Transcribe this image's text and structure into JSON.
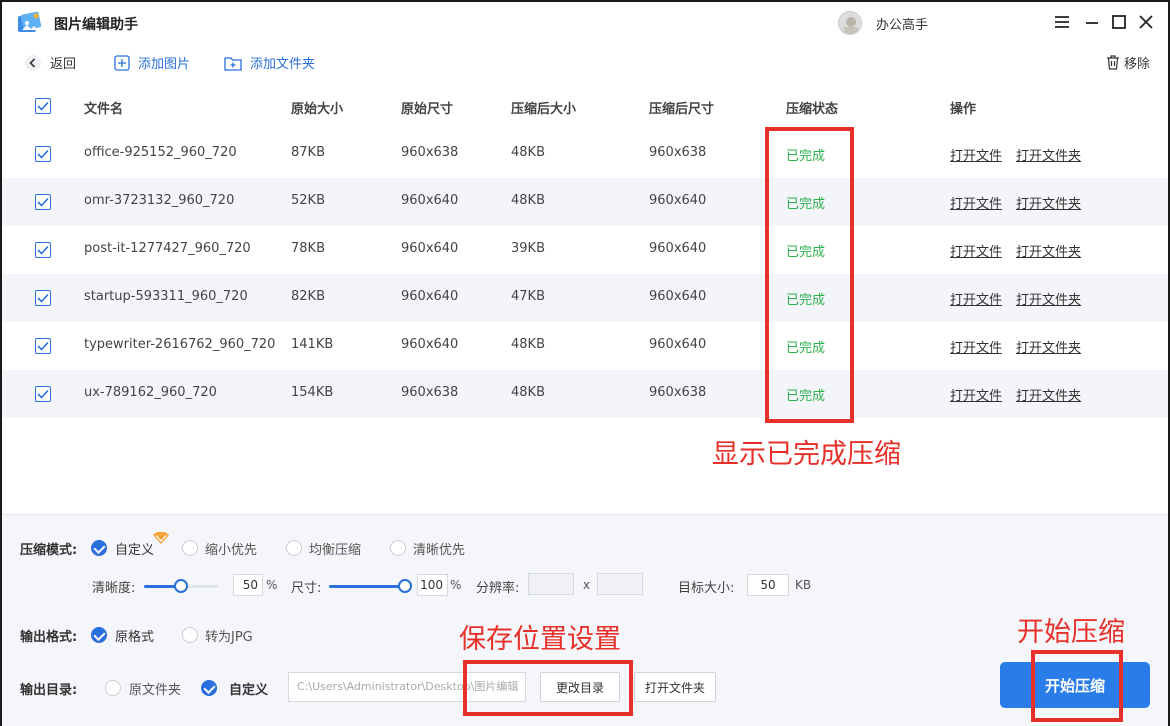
{
  "app": {
    "title": "图片编辑助手",
    "user_name": "办公高手"
  },
  "toolbar": {
    "back": "返回",
    "add_image": "添加图片",
    "add_folder": "添加文件夹",
    "remove": "移除"
  },
  "table": {
    "headers": [
      "文件名",
      "原始大小",
      "原始尺寸",
      "压缩后大小",
      "压缩后尺寸",
      "压缩状态",
      "操作"
    ],
    "rows": [
      {
        "name": "office-925152_960_720",
        "orig_size": "87KB",
        "orig_dim": "960x638",
        "new_size": "48KB",
        "new_dim": "960x638",
        "status": "已完成",
        "open_file": "打开文件",
        "open_folder": "打开文件夹"
      },
      {
        "name": "omr-3723132_960_720",
        "orig_size": "52KB",
        "orig_dim": "960x640",
        "new_size": "48KB",
        "new_dim": "960x640",
        "status": "已完成",
        "open_file": "打开文件",
        "open_folder": "打开文件夹"
      },
      {
        "name": "post-it-1277427_960_720",
        "orig_size": "78KB",
        "orig_dim": "960x640",
        "new_size": "39KB",
        "new_dim": "960x640",
        "status": "已完成",
        "open_file": "打开文件",
        "open_folder": "打开文件夹"
      },
      {
        "name": "startup-593311_960_720",
        "orig_size": "82KB",
        "orig_dim": "960x640",
        "new_size": "47KB",
        "new_dim": "960x640",
        "status": "已完成",
        "open_file": "打开文件",
        "open_folder": "打开文件夹"
      },
      {
        "name": "typewriter-2616762_960_720",
        "orig_size": "141KB",
        "orig_dim": "960x640",
        "new_size": "48KB",
        "new_dim": "960x640",
        "status": "已完成",
        "open_file": "打开文件",
        "open_folder": "打开文件夹"
      },
      {
        "name": "ux-789162_960_720",
        "orig_size": "154KB",
        "orig_dim": "960x638",
        "new_size": "48KB",
        "new_dim": "960x638",
        "status": "已完成",
        "open_file": "打开文件",
        "open_folder": "打开文件夹"
      }
    ]
  },
  "settings": {
    "mode_label": "压缩模式:",
    "modes": [
      "自定义",
      "缩小优先",
      "均衡压缩",
      "清晰优先"
    ],
    "selected_mode": "自定义",
    "clarity_label": "清晰度:",
    "clarity_value": "50",
    "size_label": "尺寸:",
    "size_value": "100",
    "percent": "%",
    "resolution_label": "分辨率:",
    "resolution_sep": "x",
    "target_label": "目标大小:",
    "target_value": "50",
    "target_unit": "KB",
    "format_label": "输出格式:",
    "formats": [
      "原格式",
      "转为JPG"
    ],
    "output_label": "输出目录:",
    "output_options": [
      "原文件夹",
      "自定义"
    ],
    "output_path": "C:\\Users\\Administrator\\Desktop\\图片编辑",
    "change_dir": "更改目录",
    "open_folder": "打开文件夹",
    "start": "开始压缩"
  },
  "annotations": {
    "completed": "显示已完成压缩",
    "save_location": "保存位置设置",
    "start": "开始压缩"
  },
  "colors": {
    "accent": "#2a6fdb",
    "status_done": "#2bb24c",
    "annotation": "#e8302a"
  }
}
